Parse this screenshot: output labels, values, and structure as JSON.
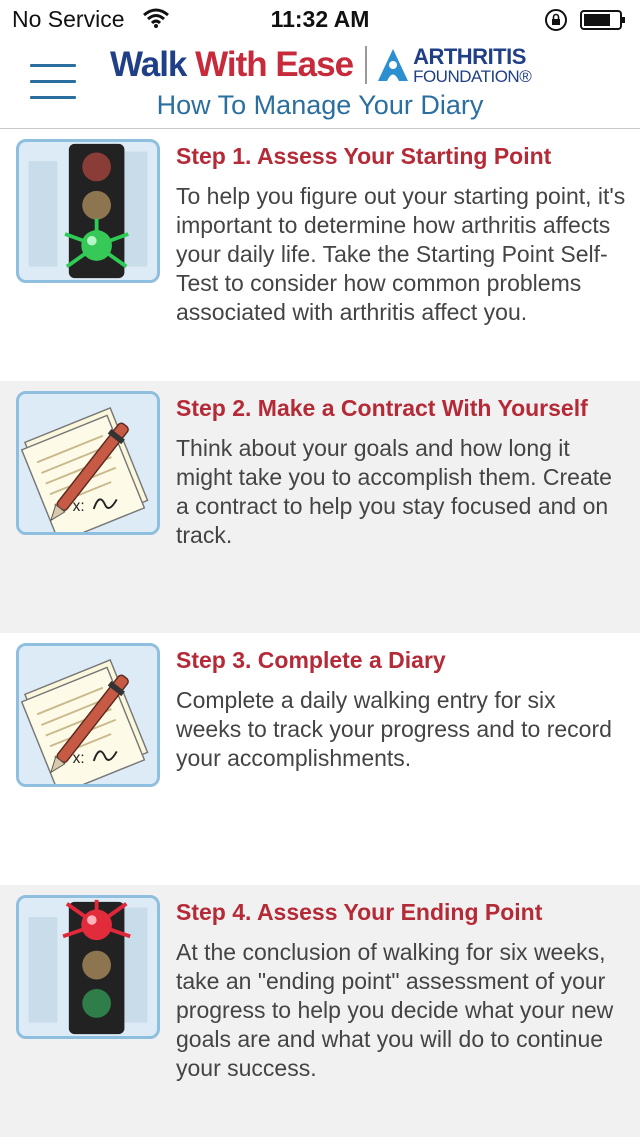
{
  "status_bar": {
    "carrier": "No Service",
    "time": "11:32 AM"
  },
  "header": {
    "logo": {
      "walk_part1": "Walk",
      "walk_part2": " With",
      "walk_part3": " Ease",
      "af_line1": "ARTHRITIS",
      "af_line2": "FOUNDATION®"
    },
    "title": "How To Manage Your Diary"
  },
  "steps": [
    {
      "icon": "traffic-light-green-icon",
      "title": "Step 1. Assess Your Starting Point",
      "description": "To help you figure out your starting point, it's important to determine how arthritis affects your daily life. Take the Starting Point Self-Test to consider how common problems associated with arthritis affect you."
    },
    {
      "icon": "contract-pen-icon",
      "title": "Step 2. Make a Contract With Yourself",
      "description": "Think about your goals and how long it might take you to accomplish them. Create a contract to help you stay focused and on track."
    },
    {
      "icon": "contract-pen-icon",
      "title": "Step 3. Complete a Diary",
      "description": "Complete a daily walking entry for six weeks to track your progress and to record your accomplishments."
    },
    {
      "icon": "traffic-light-red-icon",
      "title": "Step 4. Assess Your Ending Point",
      "description": "At the conclusion of walking for six weeks, take an \"ending point\" assessment of your progress to help you decide what your new goals are and what you will do to continue your success."
    }
  ],
  "colors": {
    "title_red": "#b42a37",
    "header_blue": "#2a6f9f",
    "brand_navy": "#1f3f86",
    "row_gray": "#f1f1f1"
  }
}
